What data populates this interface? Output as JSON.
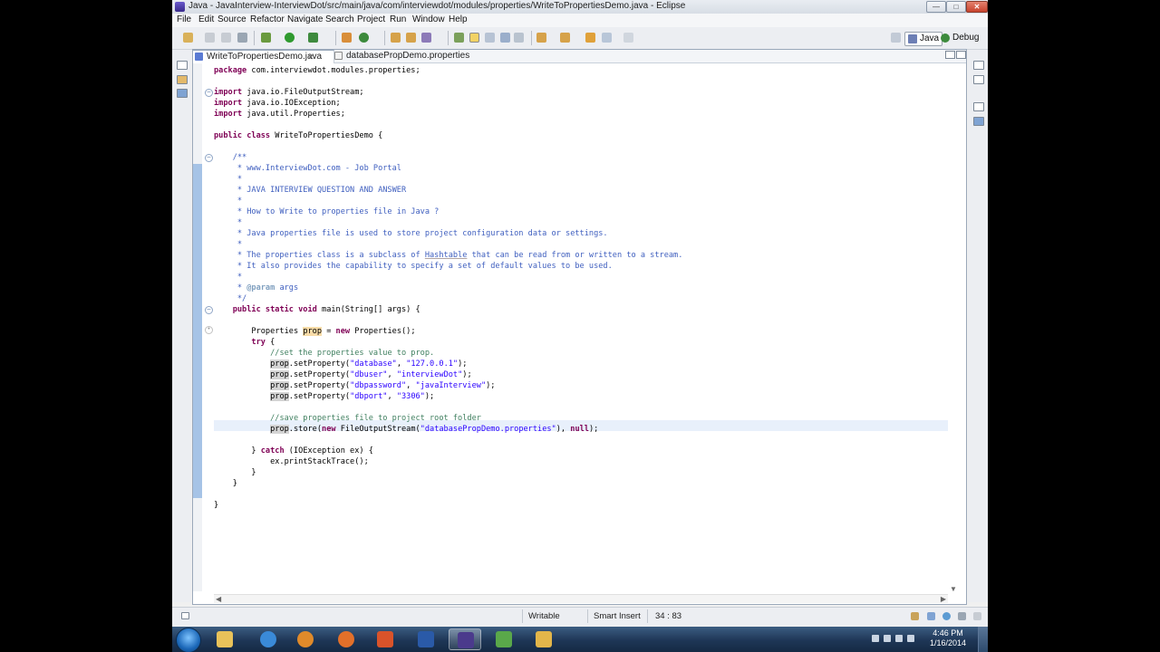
{
  "window": {
    "title": "Java - JavaInterview-InterviewDot/src/main/java/com/interviewdot/modules/properties/WriteToPropertiesDemo.java - Eclipse"
  },
  "menu": [
    "File",
    "Edit",
    "Source",
    "Refactor",
    "Navigate",
    "Search",
    "Project",
    "Run",
    "Window",
    "Help"
  ],
  "perspectives": {
    "java": "Java",
    "debug": "Debug"
  },
  "tabs": [
    {
      "label": "WriteToPropertiesDemo.java",
      "close": "✕",
      "active": true
    },
    {
      "label": "databasePropDemo.properties",
      "active": false
    }
  ],
  "code_lines": [
    "package com.interviewdot.modules.properties;",
    "",
    "import java.io.FileOutputStream;",
    "import java.io.IOException;",
    "import java.util.Properties;",
    "",
    "public class WriteToPropertiesDemo {",
    "",
    "    /**",
    "     * www.InterviewDot.com - Job Portal",
    "     *",
    "     * JAVA INTERVIEW QUESTION AND ANSWER",
    "     *",
    "     * How to Write to properties file in Java ?",
    "     *",
    "     * Java properties file is used to store project configuration data or settings.",
    "     *",
    "     * The properties class is a subclass of Hashtable that can be read from or written to a stream.",
    "     * It also provides the capability to specify a set of default values to be used.",
    "     *",
    "     * @param args",
    "     */",
    "    public static void main(String[] args) {",
    "",
    "        Properties prop = new Properties();",
    "        try {",
    "            //set the properties value to prop.",
    "            prop.setProperty(\"database\", \"127.0.0.1\");",
    "            prop.setProperty(\"dbuser\", \"interviewDot\");",
    "            prop.setProperty(\"dbpassword\", \"javaInterview\");",
    "            prop.setProperty(\"dbport\", \"3306\");",
    "",
    "            //save properties file to project root folder",
    "            prop.store(new FileOutputStream(\"databasePropDemo.properties\"), null);",
    "",
    "        } catch (IOException ex) {",
    "            ex.printStackTrace();",
    "        }",
    "    }",
    "",
    "}"
  ],
  "status": {
    "writable": "Writable",
    "insert_mode": "Smart Insert",
    "position": "34 : 83"
  },
  "clock": {
    "time": "4:46 PM",
    "date": "1/16/2014"
  },
  "colors": {
    "keyword": "#7f0055",
    "comment": "#3f7f5f",
    "javadoc": "#3f5fbf",
    "string": "#2a00ff",
    "current_line": "#e8f0fb"
  }
}
